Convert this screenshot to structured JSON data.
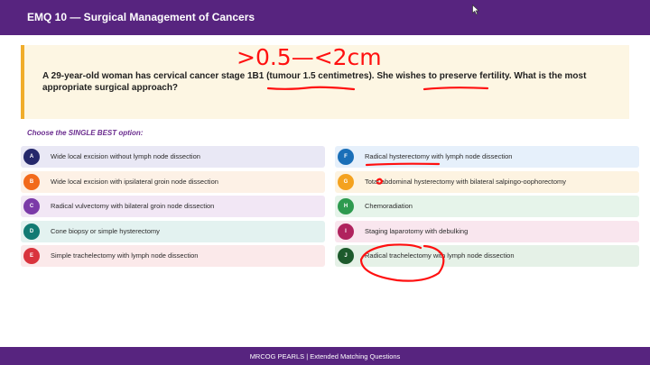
{
  "header": {
    "title": "EMQ 10 — Surgical Management of Cancers"
  },
  "question": {
    "text": "A 29-year-old woman has cervical cancer stage 1B1 (tumour 1.5 centimetres). She wishes to preserve fertility. What is the most appropriate surgical approach?"
  },
  "instruction": "Choose the SINGLE BEST option:",
  "options_left": [
    {
      "letter": "A",
      "label": "Wide local excision without lymph node dissection",
      "badge_color": "#25286b",
      "bg_color": "#e9e8f5"
    },
    {
      "letter": "B",
      "label": "Wide local excision with ipsilateral groin node dissection",
      "badge_color": "#f26a1b",
      "bg_color": "#fdf1e6"
    },
    {
      "letter": "C",
      "label": "Radical vulvectomy with bilateral groin node dissection",
      "badge_color": "#7b3aa8",
      "bg_color": "#f2e7f5"
    },
    {
      "letter": "D",
      "label": "Cone biopsy or simple hysterectomy",
      "badge_color": "#127a73",
      "bg_color": "#e3f2f0"
    },
    {
      "letter": "E",
      "label": "Simple trachelectomy with lymph node dissection",
      "badge_color": "#d9343d",
      "bg_color": "#fbe9ea"
    }
  ],
  "options_right": [
    {
      "letter": "F",
      "label": "Radical hysterectomy with lymph node dissection",
      "badge_color": "#1a6fb8",
      "bg_color": "#e6f0fb"
    },
    {
      "letter": "G",
      "label": "Total abdominal hysterectomy with bilateral salpingo-oophorectomy",
      "badge_color": "#f4a21f",
      "bg_color": "#fdf3e1"
    },
    {
      "letter": "H",
      "label": "Chemoradiation",
      "badge_color": "#2e9a4f",
      "bg_color": "#e6f4ea"
    },
    {
      "letter": "I",
      "label": "Staging laparotomy with debulking",
      "badge_color": "#b0235e",
      "bg_color": "#f9e6ee"
    },
    {
      "letter": "J",
      "label": "Radical trachelectomy with lymph node dissection",
      "badge_color": "#1d5a2c",
      "bg_color": "#e5f1e7"
    }
  ],
  "annotation": {
    "text": ">0.5—<2cm",
    "color": "#ff1010"
  },
  "footer": {
    "text": "MRCOG PEARLS  |  Extended Matching Questions"
  }
}
